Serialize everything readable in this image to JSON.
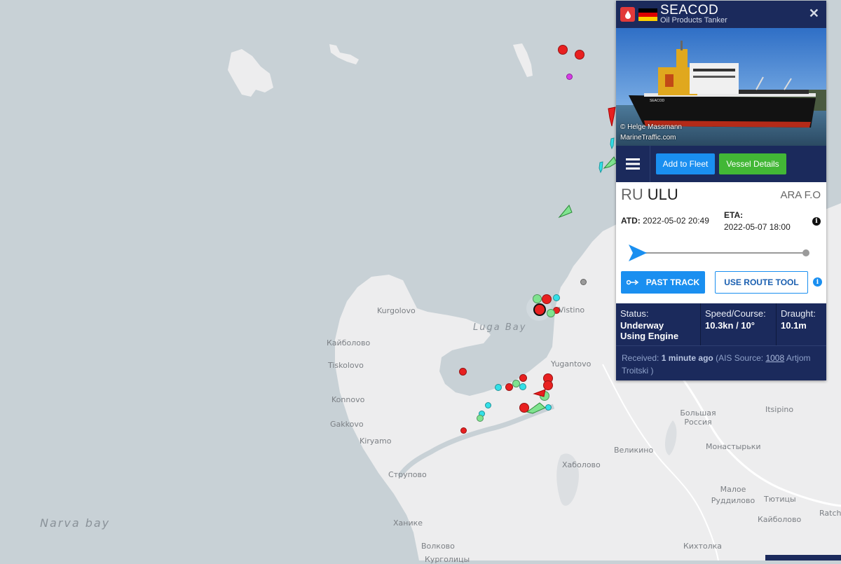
{
  "map": {
    "water_labels": [
      "Luga Bay",
      "Narva bay"
    ],
    "places": [
      "Kurgolovo",
      "Vistino",
      "Кайболово",
      "Tiskolovo",
      "Yugantovo",
      "Konnovo",
      "Gakkovo",
      "Kiryamo",
      "Струпово",
      "Хаболово",
      "Великино",
      "Большая Россия",
      "Itsipino",
      "Монастырьки",
      "Малое Руддилово",
      "Тютицы",
      "Кайболово",
      "Ханике",
      "Волково",
      "Кихтолка",
      "Ratch",
      "Курголицы"
    ]
  },
  "vessel": {
    "name": "SEACOD",
    "type": "Oil Products Tanker",
    "photo_credit_1": "© Helge Massmann",
    "photo_credit_2": "MarineTraffic.com"
  },
  "toolbar": {
    "add_fleet": "Add to Fleet",
    "vessel_details": "Vessel Details"
  },
  "voyage": {
    "departure": "RU",
    "departure_port": "ULU",
    "destination": "ARA F.O",
    "atd_label": "ATD:",
    "atd": "2022-05-02 20:49",
    "eta_label": "ETA:",
    "eta": "2022-05-07 18:00",
    "progress": 0.0
  },
  "actions": {
    "past_track": "PAST TRACK",
    "route_tool": "USE ROUTE TOOL"
  },
  "status": {
    "status_label": "Status:",
    "status_value_1": "Underway",
    "status_value_2": "Using Engine",
    "speed_label": "Speed/Course:",
    "speed_value": "10.3kn / 10°",
    "draught_label": "Draught:",
    "draught_value": "10.1m"
  },
  "received": {
    "prefix": "Received:",
    "time": "1 minute ago",
    "source_prefix": "(AIS Source:",
    "source_id": "1008",
    "source_name": "Artjom Troitski )"
  },
  "colors": {
    "header": "#1b2a5c",
    "button_blue": "#1a8ff0",
    "button_green": "#42b736",
    "tanker_red": "#e23a3a"
  }
}
